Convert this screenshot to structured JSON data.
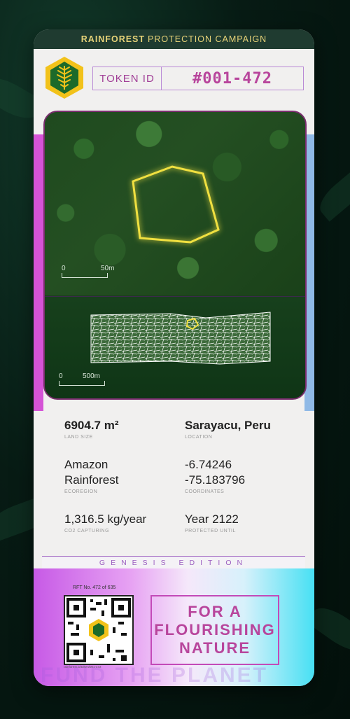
{
  "header": {
    "bold": "RAINFOREST",
    "rest": "PROTECTION CAMPAIGN"
  },
  "token": {
    "label": "TOKEN ID",
    "id": "#001-472"
  },
  "map": {
    "top_scale": "50m",
    "bottom_scale": "500m",
    "scale_zero": "0"
  },
  "info": {
    "land_size": {
      "value": "6904.7 m²",
      "label": "LAND SIZE"
    },
    "location": {
      "value": "Sarayacu, Peru",
      "label": "LOCATION"
    },
    "ecoregion": {
      "line1": "Amazon",
      "line2": "Rainforest",
      "label": "ECOREGION"
    },
    "coordinates": {
      "line1": "-6.74246",
      "line2": "-75.183796",
      "label": "COORDINATES"
    },
    "co2": {
      "value": "1,316.5 kg/year",
      "label": "CO2 CAPTURING"
    },
    "protected": {
      "value": "Year 2122",
      "label": "PROTECTED UNTIL"
    }
  },
  "edition": "GENESIS EDITION",
  "bottom": {
    "rft": "RFT No. 472 of 635",
    "url": "rainforest.io/token/001-472",
    "slogan": [
      "FOR A",
      "FLOURISHING",
      "NATURE"
    ],
    "ghost_text": "FUND THE PLANET"
  },
  "colors": {
    "accent": "#b8459c",
    "header_bg": "#1f3b30",
    "header_text": "#e6d278"
  }
}
